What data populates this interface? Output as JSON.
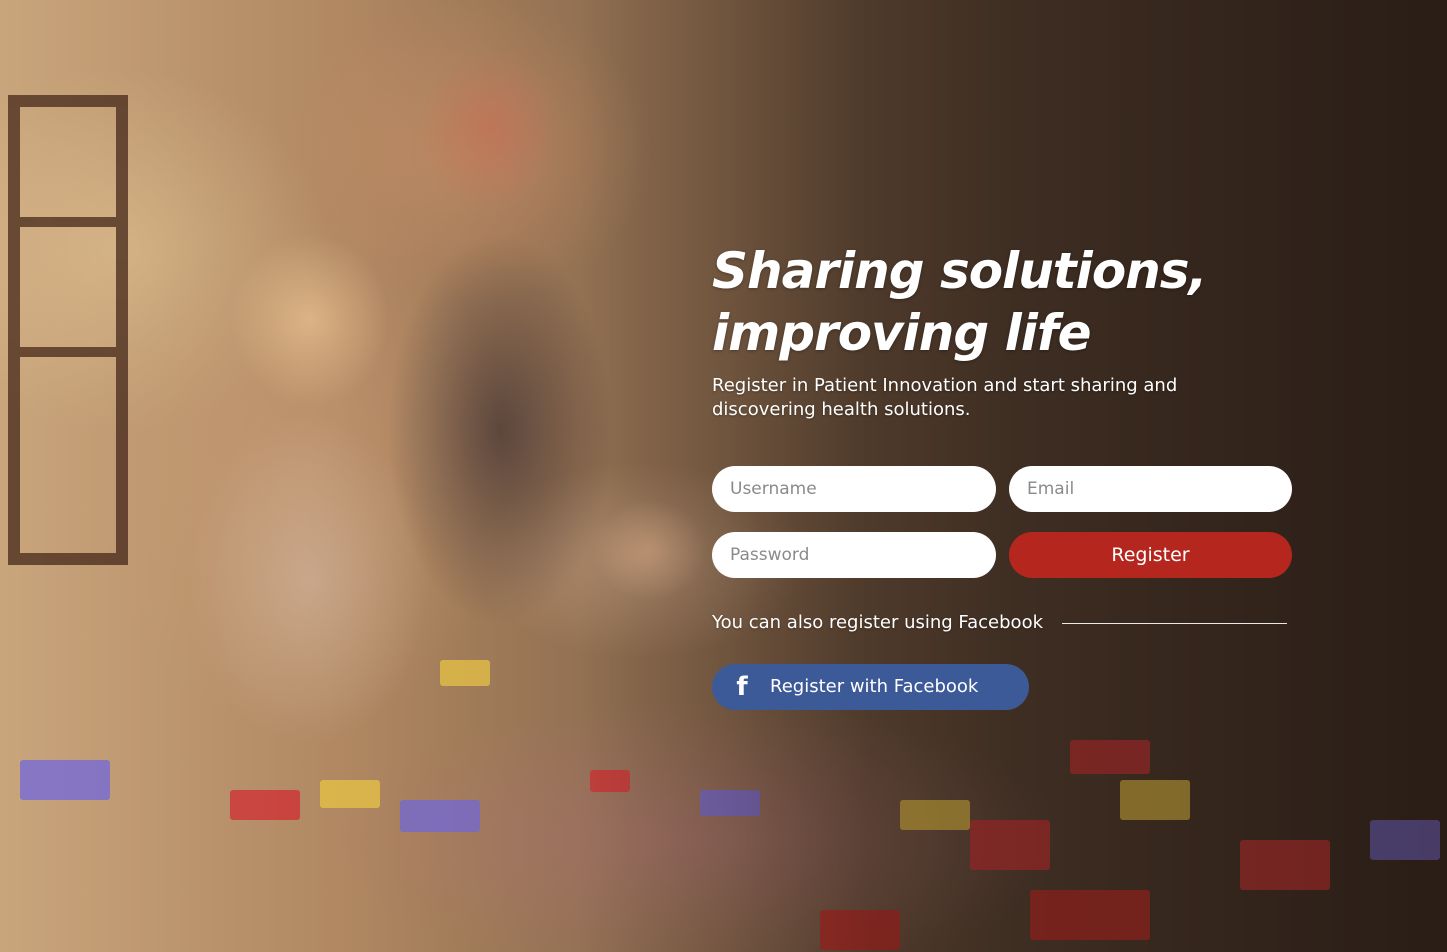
{
  "hero": {
    "headline_line1": "Sharing solutions,",
    "headline_line2": "improving life",
    "subtitle": "Register in Patient Innovation and start sharing and discovering health solutions."
  },
  "form": {
    "username_placeholder": "Username",
    "email_placeholder": "Email",
    "password_placeholder": "Password",
    "register_label": "Register"
  },
  "alternative": {
    "text": "You can also register using Facebook",
    "facebook_icon": "f",
    "facebook_label": "Register with Facebook"
  },
  "colors": {
    "register_button": "#b5271e",
    "facebook_button": "#3d5a98",
    "text": "#ffffff"
  },
  "icons": {
    "facebook": "facebook-icon"
  }
}
